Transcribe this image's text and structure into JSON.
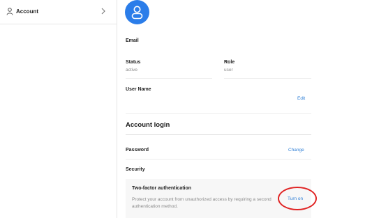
{
  "sidebar": {
    "items": [
      {
        "label": "Account",
        "icon": "user-icon"
      }
    ]
  },
  "profile": {
    "email_label": "Email",
    "status_label": "Status",
    "status_value": "active",
    "role_label": "Role",
    "role_value": "user",
    "username_label": "User Name",
    "edit_label": "Edit"
  },
  "account_login": {
    "title": "Account login",
    "password_label": "Password",
    "change_label": "Change",
    "security_label": "Security",
    "two_factor": {
      "title": "Two-factor authentication",
      "description": "Protect your account from unauthorized access by requiring a second authentication method.",
      "action_label": "Turn on"
    }
  },
  "colors": {
    "accent": "#2b7de9",
    "link": "#2f7fd6",
    "highlight": "#e02424"
  }
}
